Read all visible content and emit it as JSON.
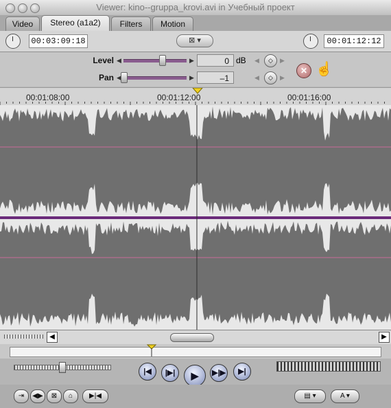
{
  "window": {
    "title": "Viewer: kino--gruppa_krovi.avi in Учебный проект"
  },
  "tabs": [
    {
      "label": "Video",
      "active": false
    },
    {
      "label": "Stereo (a1a2)",
      "active": true
    },
    {
      "label": "Filters",
      "active": false
    },
    {
      "label": "Motion",
      "active": false
    }
  ],
  "timecode": {
    "duration": "00:03:09:18",
    "current": "00:01:12:12",
    "middle_button_icon": "playhead-sync-icon"
  },
  "audio_controls": {
    "level": {
      "label": "Level",
      "value": "0",
      "unit": "dB"
    },
    "pan": {
      "label": "Pan",
      "value": "–1"
    },
    "reset_icon": "reset-x-icon",
    "drag_hand_icon": "hand-icon"
  },
  "ruler": {
    "ticks": [
      "00:01:08:00",
      "00:01:12:00",
      "00:01:16:00"
    ],
    "playhead_color": "#f0d020"
  },
  "colors": {
    "waveform": "#6f6f6f",
    "pink_line": "#c86b9a",
    "purple_divider": "#6a2b7a"
  },
  "transport": {
    "buttons": [
      "|◀",
      "|▶|",
      "▶",
      "▶|▶",
      "▶|"
    ]
  },
  "bottom_bar": {
    "buttons": [
      "⇥",
      "◀▶",
      "⊠",
      "⌂",
      "▶|◀"
    ],
    "popups": [
      "▤ ▾",
      "A ▾"
    ]
  }
}
